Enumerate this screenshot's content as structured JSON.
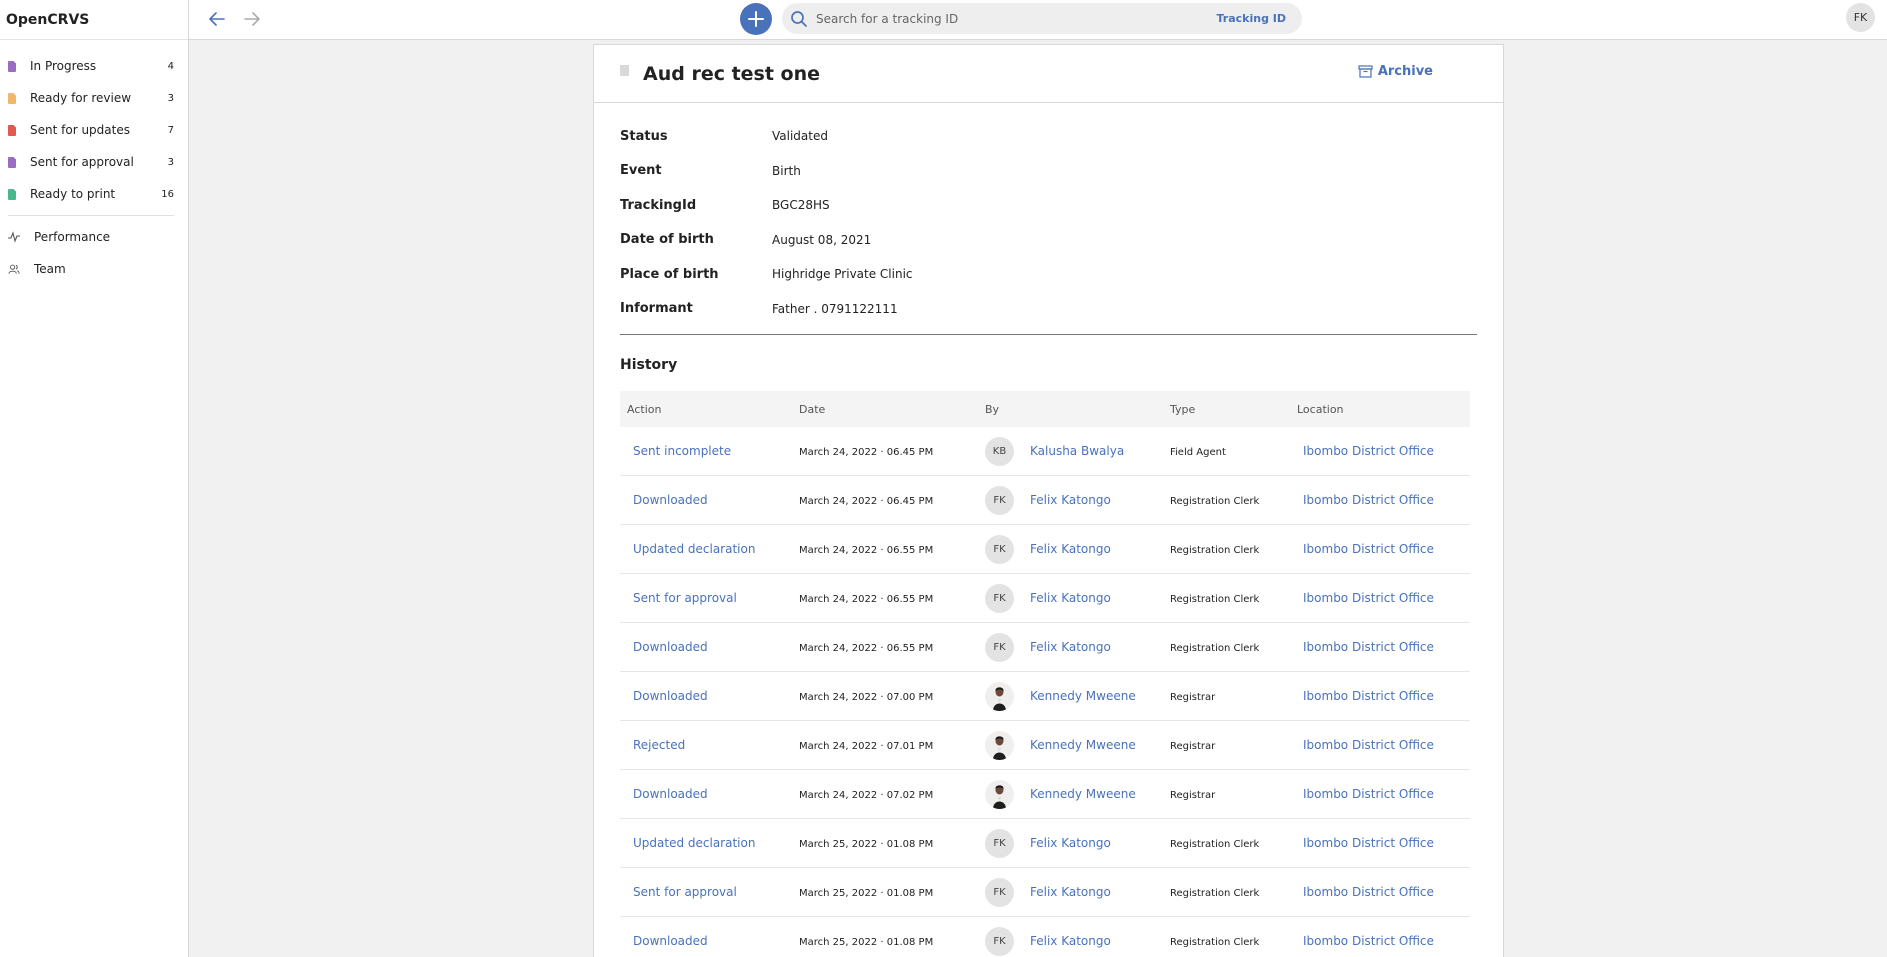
{
  "app": {
    "brand": "OpenCRVS"
  },
  "sidebar": {
    "items": [
      {
        "label": "In Progress",
        "count": "4",
        "color": "#9b6cc4"
      },
      {
        "label": "Ready for review",
        "count": "3",
        "color": "#f0b868"
      },
      {
        "label": "Sent for updates",
        "count": "7",
        "color": "#e15a4f"
      },
      {
        "label": "Sent for approval",
        "count": "3",
        "color": "#9b6cc4"
      },
      {
        "label": "Ready to print",
        "count": "16",
        "color": "#49b78d"
      }
    ],
    "links": [
      {
        "label": "Performance",
        "icon": "activity-icon"
      },
      {
        "label": "Team",
        "icon": "users-icon"
      }
    ]
  },
  "topbar": {
    "search_placeholder": "Search for a tracking ID",
    "search_type": "Tracking ID",
    "user_initials": "FK"
  },
  "record": {
    "title": "Aud rec test one",
    "archive_label": "Archive",
    "details": [
      {
        "key": "Status",
        "value": "Validated"
      },
      {
        "key": "Event",
        "value": "Birth"
      },
      {
        "key": "TrackingId",
        "value": "BGC28HS"
      },
      {
        "key": "Date of birth",
        "value": "August 08, 2021"
      },
      {
        "key": "Place of birth",
        "value": "Highridge Private Clinic"
      },
      {
        "key": "Informant",
        "value": "Father . 0791122111"
      }
    ]
  },
  "history": {
    "title": "History",
    "columns": [
      "Action",
      "Date",
      "By",
      "Type",
      "Location"
    ],
    "rows": [
      {
        "action": "Sent incomplete",
        "date": "March 24, 2022 · 06.45 PM",
        "initials": "KB",
        "by": "Kalusha Bwalya",
        "type": "Field Agent",
        "location": "Ibombo District Office"
      },
      {
        "action": "Downloaded",
        "date": "March 24, 2022 · 06.45 PM",
        "initials": "FK",
        "by": "Felix Katongo",
        "type": "Registration Clerk",
        "location": "Ibombo District Office"
      },
      {
        "action": "Updated declaration",
        "date": "March 24, 2022 · 06.55 PM",
        "initials": "FK",
        "by": "Felix Katongo",
        "type": "Registration Clerk",
        "location": "Ibombo District Office"
      },
      {
        "action": "Sent for approval",
        "date": "March 24, 2022 · 06.55 PM",
        "initials": "FK",
        "by": "Felix Katongo",
        "type": "Registration Clerk",
        "location": "Ibombo District Office"
      },
      {
        "action": "Downloaded",
        "date": "March 24, 2022 · 06.55 PM",
        "initials": "FK",
        "by": "Felix Katongo",
        "type": "Registration Clerk",
        "location": "Ibombo District Office"
      },
      {
        "action": "Downloaded",
        "date": "March 24, 2022 · 07.00 PM",
        "initials": "",
        "by": "Kennedy Mweene",
        "type": "Registrar",
        "location": "Ibombo District Office"
      },
      {
        "action": "Rejected",
        "date": "March 24, 2022 · 07.01 PM",
        "initials": "",
        "by": "Kennedy Mweene",
        "type": "Registrar",
        "location": "Ibombo District Office"
      },
      {
        "action": "Downloaded",
        "date": "March 24, 2022 · 07.02 PM",
        "initials": "",
        "by": "Kennedy Mweene",
        "type": "Registrar",
        "location": "Ibombo District Office"
      },
      {
        "action": "Updated declaration",
        "date": "March 25, 2022 · 01.08 PM",
        "initials": "FK",
        "by": "Felix Katongo",
        "type": "Registration Clerk",
        "location": "Ibombo District Office"
      },
      {
        "action": "Sent for approval",
        "date": "March 25, 2022 · 01.08 PM",
        "initials": "FK",
        "by": "Felix Katongo",
        "type": "Registration Clerk",
        "location": "Ibombo District Office"
      },
      {
        "action": "Downloaded",
        "date": "March 25, 2022 · 01.08 PM",
        "initials": "FK",
        "by": "Felix Katongo",
        "type": "Registration Clerk",
        "location": "Ibombo District Office"
      }
    ]
  }
}
